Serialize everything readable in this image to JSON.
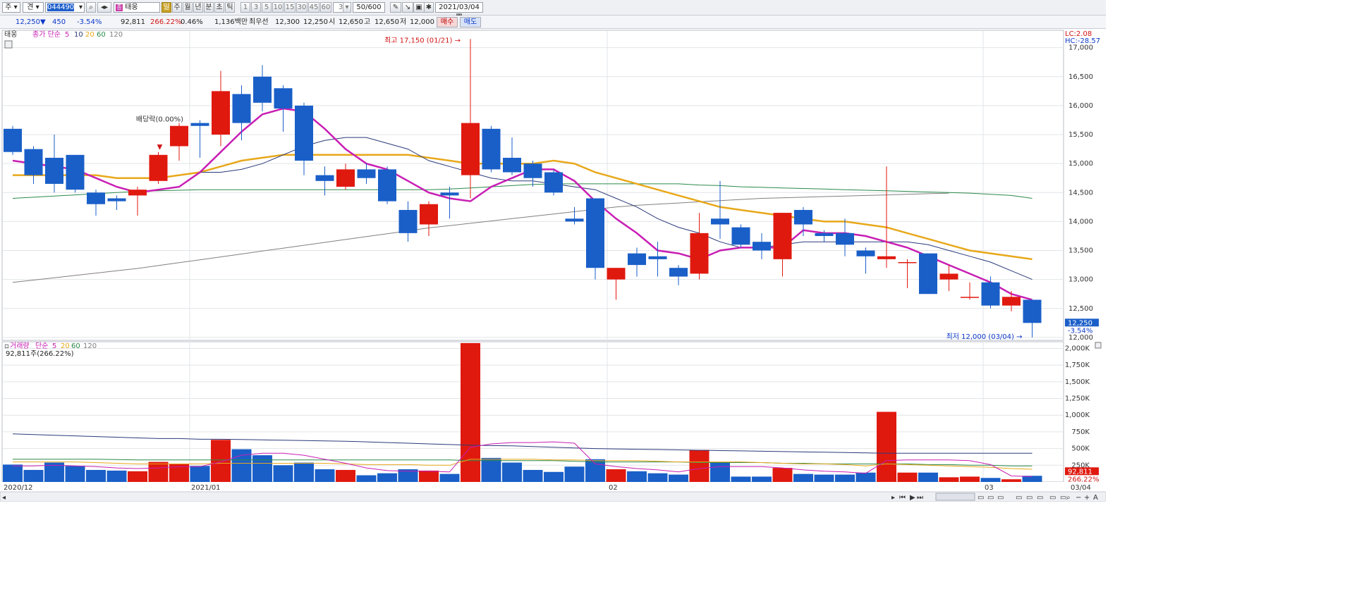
{
  "toolbar": {
    "market_sel": "주",
    "code_label": "견",
    "stock_code": "044490",
    "stock_name": "태웅",
    "period_buttons": [
      "일",
      "주",
      "월",
      "년",
      "분",
      "초",
      "틱"
    ],
    "interval_buttons": [
      "1",
      "3",
      "5",
      "10",
      "15",
      "30",
      "45",
      "60"
    ],
    "interval_value": "3",
    "count": "50/600",
    "date": "2021/03/04"
  },
  "quote": {
    "price": "12,250▼",
    "change": "450",
    "change_pct": "-3.54%",
    "volume": "92,811",
    "volume_ratio": "266.22%",
    "turnover": "0.46%",
    "amount": "1,136백만",
    "bid_label": "최우선",
    "bid1": "12,300",
    "bid2": "12,250",
    "open_label": "시",
    "open": "12,650",
    "high_label": "고",
    "high": "12,650",
    "low_label": "저",
    "low": "12,000",
    "buy_button": "매수",
    "sell_button": "매도"
  },
  "colors": {
    "up": "#e0190f",
    "down": "#1a5fc8",
    "ma5": "#c81eb4",
    "ma10": "#2b3a7a",
    "ma20": "#e8a81a",
    "ma60": "#2a8a4a",
    "ma120": "#808080"
  },
  "chart_data": [
    {
      "type": "candlestick",
      "legend": {
        "name": "태웅",
        "series": [
          "종가 단순",
          "5",
          "10",
          "20",
          "60",
          "120"
        ]
      },
      "indicators": {
        "lc": "LC:2.08",
        "hc": "HC:-28.57"
      },
      "yticks": [
        "17,000",
        "16,500",
        "16,000",
        "15,500",
        "15,000",
        "14,500",
        "14,000",
        "13,500",
        "13,000",
        "12,500",
        "12,000"
      ],
      "ylim": [
        11950,
        17300
      ],
      "current_price": "12,250",
      "current_change": "-3.54%",
      "max_annotation": "최고 17,150 (01/21)",
      "min_annotation": "최저 12,000 (03/04)",
      "event_annotation": "배당락(0.00%)",
      "x_labels": [
        "2020/12",
        "2021/01",
        "02",
        "03"
      ],
      "candles": [
        {
          "o": 15600,
          "h": 15650,
          "l": 15150,
          "c": 15200
        },
        {
          "o": 15250,
          "h": 15300,
          "l": 14650,
          "c": 14800
        },
        {
          "o": 15100,
          "h": 15500,
          "l": 14500,
          "c": 14650
        },
        {
          "o": 15150,
          "h": 15150,
          "l": 14500,
          "c": 14550
        },
        {
          "o": 14500,
          "h": 14550,
          "l": 14100,
          "c": 14300
        },
        {
          "o": 14400,
          "h": 14450,
          "l": 14200,
          "c": 14350
        },
        {
          "o": 14450,
          "h": 14600,
          "l": 14100,
          "c": 14550
        },
        {
          "o": 14700,
          "h": 15200,
          "l": 14650,
          "c": 15150
        },
        {
          "o": 15300,
          "h": 15700,
          "l": 15050,
          "c": 15650
        },
        {
          "o": 15700,
          "h": 15750,
          "l": 15100,
          "c": 15650
        },
        {
          "o": 15500,
          "h": 16600,
          "l": 15300,
          "c": 16250
        },
        {
          "o": 16200,
          "h": 16350,
          "l": 15400,
          "c": 15700
        },
        {
          "o": 16500,
          "h": 16700,
          "l": 15900,
          "c": 16050
        },
        {
          "o": 16300,
          "h": 16350,
          "l": 15550,
          "c": 15950
        },
        {
          "o": 16000,
          "h": 16050,
          "l": 14800,
          "c": 15050
        },
        {
          "o": 14800,
          "h": 14950,
          "l": 14450,
          "c": 14700
        },
        {
          "o": 14600,
          "h": 15000,
          "l": 14550,
          "c": 14900
        },
        {
          "o": 14900,
          "h": 15000,
          "l": 14650,
          "c": 14750
        },
        {
          "o": 14900,
          "h": 14950,
          "l": 14300,
          "c": 14350
        },
        {
          "o": 14200,
          "h": 14350,
          "l": 13650,
          "c": 13800
        },
        {
          "o": 13950,
          "h": 14350,
          "l": 13750,
          "c": 14300
        },
        {
          "o": 14500,
          "h": 14600,
          "l": 14050,
          "c": 14450
        },
        {
          "o": 14800,
          "h": 17150,
          "l": 14400,
          "c": 15700
        },
        {
          "o": 15600,
          "h": 15650,
          "l": 14850,
          "c": 14900
        },
        {
          "o": 15100,
          "h": 15450,
          "l": 14800,
          "c": 14850
        },
        {
          "o": 15000,
          "h": 15050,
          "l": 14600,
          "c": 14750
        },
        {
          "o": 14850,
          "h": 14900,
          "l": 14450,
          "c": 14500
        },
        {
          "o": 14050,
          "h": 14250,
          "l": 13950,
          "c": 14000
        },
        {
          "o": 14400,
          "h": 14400,
          "l": 13000,
          "c": 13200
        },
        {
          "o": 13000,
          "h": 13200,
          "l": 12650,
          "c": 13200
        },
        {
          "o": 13450,
          "h": 13550,
          "l": 13050,
          "c": 13250
        },
        {
          "o": 13400,
          "h": 13650,
          "l": 13050,
          "c": 13350
        },
        {
          "o": 13200,
          "h": 13250,
          "l": 12900,
          "c": 13050
        },
        {
          "o": 13100,
          "h": 14150,
          "l": 13000,
          "c": 13800
        },
        {
          "o": 14050,
          "h": 14700,
          "l": 13700,
          "c": 13950
        },
        {
          "o": 13900,
          "h": 13950,
          "l": 13550,
          "c": 13600
        },
        {
          "o": 13650,
          "h": 13800,
          "l": 13350,
          "c": 13500
        },
        {
          "o": 13350,
          "h": 14150,
          "l": 13050,
          "c": 14150
        },
        {
          "o": 14200,
          "h": 14250,
          "l": 13750,
          "c": 13950
        },
        {
          "o": 13800,
          "h": 13850,
          "l": 13650,
          "c": 13750
        },
        {
          "o": 13800,
          "h": 14050,
          "l": 13400,
          "c": 13600
        },
        {
          "o": 13500,
          "h": 13550,
          "l": 13100,
          "c": 13400
        },
        {
          "o": 13350,
          "h": 14950,
          "l": 13200,
          "c": 13400
        },
        {
          "o": 13300,
          "h": 13350,
          "l": 12850,
          "c": 13300
        },
        {
          "o": 13450,
          "h": 13450,
          "l": 12750,
          "c": 12750
        },
        {
          "o": 13000,
          "h": 13250,
          "l": 12800,
          "c": 13100
        },
        {
          "o": 12700,
          "h": 12950,
          "l": 12650,
          "c": 12700
        },
        {
          "o": 12950,
          "h": 13050,
          "l": 12500,
          "c": 12550
        },
        {
          "o": 12550,
          "h": 12800,
          "l": 12450,
          "c": 12700
        },
        {
          "o": 12650,
          "h": 12650,
          "l": 12000,
          "c": 12250
        }
      ],
      "ma5": [
        15050,
        15000,
        14950,
        14900,
        14750,
        14600,
        14500,
        14550,
        14600,
        14850,
        15200,
        15550,
        15850,
        15950,
        15900,
        15600,
        15250,
        15000,
        14900,
        14700,
        14500,
        14400,
        14350,
        14600,
        14750,
        14900,
        14900,
        14700,
        14350,
        14050,
        13800,
        13500,
        13450,
        13350,
        13500,
        13550,
        13550,
        13550,
        13850,
        13800,
        13800,
        13750,
        13650,
        13550,
        13400,
        13250,
        13100,
        12950,
        12750,
        12650
      ],
      "ma10": [
        null,
        null,
        null,
        null,
        null,
        null,
        null,
        null,
        null,
        14850,
        14850,
        14900,
        15000,
        15150,
        15300,
        15400,
        15450,
        15450,
        15350,
        15250,
        15050,
        14950,
        14850,
        14750,
        14700,
        14700,
        14650,
        14600,
        14550,
        14400,
        14250,
        14050,
        13900,
        13800,
        13650,
        13550,
        13550,
        13600,
        13650,
        13650,
        13650,
        13650,
        13650,
        13650,
        13600,
        13500,
        13400,
        13300,
        13150,
        13000
      ],
      "ma20": [
        14800,
        14800,
        14800,
        14800,
        14800,
        14750,
        14750,
        14750,
        14800,
        14850,
        14950,
        15050,
        15100,
        15150,
        15150,
        15150,
        15150,
        15150,
        15150,
        15150,
        15100,
        15050,
        15000,
        15000,
        15000,
        15000,
        15050,
        15000,
        14850,
        14750,
        14650,
        14550,
        14450,
        14350,
        14250,
        14200,
        14150,
        14100,
        14050,
        14000,
        14000,
        13950,
        13900,
        13800,
        13700,
        13600,
        13500,
        13450,
        13400,
        13350
      ],
      "ma60": [
        14400,
        14420,
        14440,
        14460,
        14480,
        14500,
        14520,
        14530,
        14540,
        14550,
        14550,
        14550,
        14550,
        14550,
        14550,
        14550,
        14550,
        14550,
        14550,
        14550,
        14550,
        14560,
        14580,
        14600,
        14620,
        14640,
        14650,
        14650,
        14650,
        14650,
        14650,
        14650,
        14650,
        14630,
        14620,
        14600,
        14590,
        14580,
        14570,
        14560,
        14550,
        14540,
        14530,
        14520,
        14510,
        14500,
        14490,
        14470,
        14450,
        14400
      ],
      "ma120": [
        12950,
        12990,
        13030,
        13070,
        13110,
        13150,
        13190,
        13240,
        13290,
        13340,
        13390,
        13440,
        13490,
        13540,
        13590,
        13640,
        13690,
        13740,
        13790,
        13840,
        13890,
        13930,
        13970,
        14010,
        14050,
        14090,
        14130,
        14170,
        14210,
        14250,
        14280,
        14300,
        14320,
        14340,
        14360,
        14380,
        14400,
        14410,
        14420,
        14430,
        14440,
        14450,
        14460,
        14470,
        14480,
        14490,
        null,
        null,
        null,
        null
      ]
    },
    {
      "type": "bar",
      "legend": {
        "name": "거래량",
        "series": [
          "단순",
          "5",
          "20",
          "60",
          "120"
        ]
      },
      "volume_label": "92,811주(266.22%)",
      "yticks": [
        "2,000K",
        "1,750K",
        "1,500K",
        "1,250K",
        "1,000K",
        "750K",
        "500K",
        "250K"
      ],
      "ylim": [
        0,
        2100
      ],
      "current_volume": "92,811",
      "current_pct": "266.22%",
      "date_end": "03/04",
      "volumes": [
        260,
        180,
        290,
        240,
        180,
        170,
        160,
        300,
        270,
        240,
        630,
        490,
        400,
        250,
        290,
        190,
        180,
        100,
        130,
        190,
        170,
        120,
        2080,
        360,
        290,
        180,
        150,
        230,
        340,
        190,
        160,
        130,
        110,
        480,
        300,
        80,
        80,
        210,
        120,
        110,
        110,
        140,
        1050,
        140,
        140,
        70,
        80,
        60,
        40,
        92
      ],
      "vma5": [
        240,
        240,
        250,
        240,
        230,
        210,
        200,
        210,
        230,
        230,
        300,
        400,
        430,
        430,
        400,
        340,
        280,
        210,
        170,
        160,
        160,
        150,
        520,
        570,
        590,
        590,
        600,
        580,
        270,
        230,
        200,
        180,
        150,
        200,
        230,
        230,
        230,
        210,
        180,
        160,
        150,
        130,
        320,
        330,
        330,
        330,
        320,
        260,
        90,
        80
      ],
      "vma20": [
        300,
        300,
        300,
        300,
        290,
        280,
        270,
        270,
        270,
        270,
        280,
        280,
        280,
        280,
        280,
        280,
        270,
        260,
        260,
        260,
        250,
        250,
        340,
        340,
        340,
        340,
        330,
        330,
        320,
        320,
        320,
        310,
        300,
        300,
        300,
        300,
        290,
        280,
        270,
        270,
        260,
        240,
        270,
        260,
        250,
        240,
        230,
        220,
        200,
        190
      ],
      "vma60": [
        340,
        340,
        340,
        340,
        340,
        335,
        330,
        330,
        330,
        330,
        330,
        330,
        330,
        330,
        330,
        330,
        330,
        330,
        330,
        330,
        330,
        330,
        320,
        320,
        320,
        320,
        320,
        310,
        300,
        300,
        300,
        300,
        300,
        290,
        290,
        290,
        290,
        280,
        280,
        270,
        270,
        270,
        270,
        270,
        260,
        260,
        250,
        250,
        240,
        240
      ],
      "vma120": [
        720,
        710,
        700,
        690,
        680,
        670,
        660,
        650,
        650,
        640,
        640,
        635,
        630,
        625,
        620,
        615,
        610,
        600,
        590,
        580,
        570,
        560,
        550,
        545,
        540,
        530,
        520,
        510,
        500,
        495,
        490,
        485,
        480,
        475,
        470,
        465,
        460,
        455,
        450,
        445,
        440,
        435,
        430,
        430,
        430,
        430,
        430,
        430,
        430,
        430
      ]
    }
  ]
}
